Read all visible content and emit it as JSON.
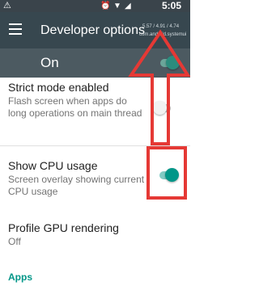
{
  "status_bar": {
    "time": "5:05",
    "icons": [
      "warning-icon",
      "alarm-icon",
      "signal-icon",
      "sim-icon",
      "battery-icon"
    ]
  },
  "app_bar": {
    "title": "Developer options",
    "menu_icon": "hamburger-menu-icon"
  },
  "cpu_overlay": {
    "load": "5.57 / 4.91 / 4.74",
    "process": "com.android.systemui"
  },
  "master_switch": {
    "label": "On",
    "checked": true
  },
  "settings": [
    {
      "title": "Strict mode enabled",
      "summary": "Flash screen when apps do long operations on main thread",
      "checked": false
    },
    {
      "title": "Show CPU usage",
      "summary": "Screen overlay showing current CPU usage",
      "checked": true
    },
    {
      "title": "Profile GPU rendering",
      "summary": "Off"
    }
  ],
  "section_header": "Apps",
  "colors": {
    "status_bar": "#3a444b",
    "app_bar": "#37474f",
    "master_bar": "#4c5a61",
    "accent": "#009688",
    "annotation": "#e53935"
  }
}
